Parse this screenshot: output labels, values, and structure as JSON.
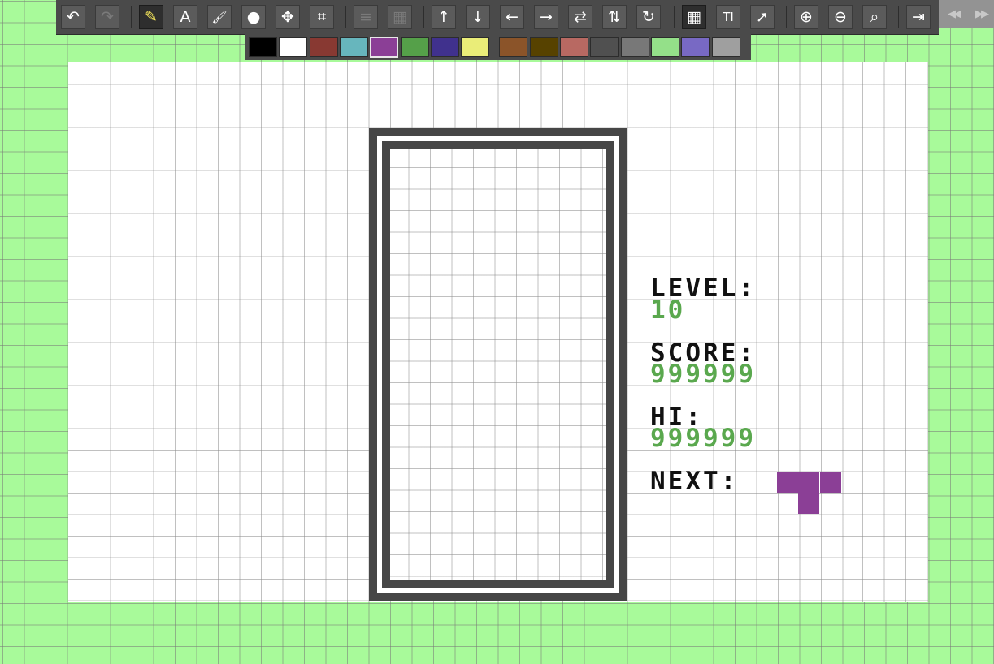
{
  "toolbar": {
    "buttons": [
      {
        "name": "undo-button",
        "glyph": "↶",
        "state": "enabled"
      },
      {
        "name": "redo-button",
        "glyph": "↷",
        "state": "disabled"
      },
      {
        "name": "pencil-tool-button",
        "glyph": "✎",
        "state": "active"
      },
      {
        "name": "text-tool-button",
        "glyph": "A",
        "state": "enabled"
      },
      {
        "name": "brush-tool-button",
        "glyph": "🖌",
        "state": "enabled"
      },
      {
        "name": "fill-tool-button",
        "glyph": "●",
        "state": "enabled"
      },
      {
        "name": "move-tool-button",
        "glyph": "✥",
        "state": "enabled"
      },
      {
        "name": "crop-tool-button",
        "glyph": "⌗",
        "state": "enabled"
      },
      {
        "name": "layers-button",
        "glyph": "≡",
        "state": "disabled"
      },
      {
        "name": "tiles-button",
        "glyph": "▦",
        "state": "disabled"
      },
      {
        "name": "shift-up-button",
        "glyph": "↑",
        "state": "enabled"
      },
      {
        "name": "shift-down-button",
        "glyph": "↓",
        "state": "enabled"
      },
      {
        "name": "shift-left-button",
        "glyph": "←",
        "state": "enabled"
      },
      {
        "name": "shift-right-button",
        "glyph": "→",
        "state": "enabled"
      },
      {
        "name": "flip-horizontal-button",
        "glyph": "⇄",
        "state": "enabled"
      },
      {
        "name": "flip-vertical-button",
        "glyph": "⇅",
        "state": "enabled"
      },
      {
        "name": "rotate-button",
        "glyph": "↻",
        "state": "enabled"
      },
      {
        "name": "grid-toggle-button",
        "glyph": "▦",
        "state": "active"
      },
      {
        "name": "text-size-button",
        "glyph": "TI",
        "state": "enabled"
      },
      {
        "name": "launch-button",
        "glyph": "➚",
        "state": "enabled"
      },
      {
        "name": "zoom-in-button",
        "glyph": "⊕",
        "state": "enabled"
      },
      {
        "name": "zoom-out-button",
        "glyph": "⊖",
        "state": "enabled"
      },
      {
        "name": "zoom-reset-button",
        "glyph": "⌕",
        "state": "enabled"
      },
      {
        "name": "export-button",
        "glyph": "⇥",
        "state": "enabled"
      }
    ],
    "side_buttons": [
      {
        "name": "rewind-button",
        "glyph": "◀◀"
      },
      {
        "name": "fast-forward-button",
        "glyph": "▶▶"
      }
    ]
  },
  "palette": {
    "colors": [
      "#000000",
      "#ffffff",
      "#883932",
      "#67b6bd",
      "#8b3f96",
      "#55a049",
      "#40318d",
      "#eaed78",
      "#8b5429",
      "#574200",
      "#b86962",
      "#505050",
      "#787878",
      "#94e089",
      "#7869c4",
      "#9f9f9f"
    ],
    "selected_index": 4
  },
  "hud": {
    "level_label": "LEVEL:",
    "level_value": "10",
    "score_label": "SCORE:",
    "score_value": "999999",
    "hi_label": "HI:",
    "hi_value": "999999",
    "next_label": "NEXT:"
  },
  "next_piece": {
    "shape": "T",
    "color": "#8b3f96",
    "cells": [
      [
        0,
        0
      ],
      [
        1,
        0
      ],
      [
        2,
        0
      ],
      [
        1,
        1
      ]
    ]
  }
}
